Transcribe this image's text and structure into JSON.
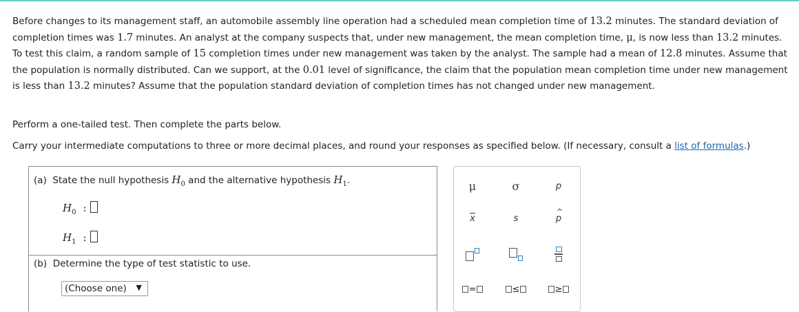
{
  "problem": {
    "intro": "Before changes to its management staff, an automobile assembly line operation had a scheduled mean completion time of ",
    "v1": "13.2",
    "t1": " minutes. The standard deviation of completion times was ",
    "v2": "1.7",
    "t2": " minutes. An analyst at the company suspects that, under new management, the mean completion time, ",
    "mu": "μ",
    "t3": ", is now less than ",
    "v3": "13.2",
    "t4": " minutes. To test this claim, a random sample of ",
    "v4": "15",
    "t5": " completion times under new management was taken by the analyst. The sample had a mean of ",
    "v5": "12.8",
    "t6": " minutes. Assume that the population is normally distributed. Can we support, at the ",
    "v6": "0.01",
    "t7": " level of significance, the claim that the population mean completion time under new management is less than ",
    "v7": "13.2",
    "t8": " minutes? Assume that the population standard deviation of completion times has not changed under new management."
  },
  "instructions": {
    "test": "Perform a one-tailed test. Then complete the parts below.",
    "carry": "Carry your intermediate computations to three or more decimal places, and round your responses as specified below. (If necessary, consult a ",
    "link": "list of formulas",
    "end": ".)"
  },
  "part_a": {
    "label": "(a)",
    "text1": "State the null hypothesis ",
    "h": "H",
    "sub0": "0",
    "text2": " and the alternative hypothesis ",
    "sub1": "1",
    "period": ".",
    "colon": ":"
  },
  "part_b": {
    "label": "(b)",
    "text": "Determine the type of test statistic to use.",
    "select_value": "(Choose one)",
    "arrow": "▼"
  },
  "palette": {
    "mu": "μ",
    "sigma": "σ",
    "p": "p",
    "xbar": "x",
    "s": "s",
    "phat": "p",
    "eq": "=",
    "le": "≤",
    "ge": "≥"
  }
}
